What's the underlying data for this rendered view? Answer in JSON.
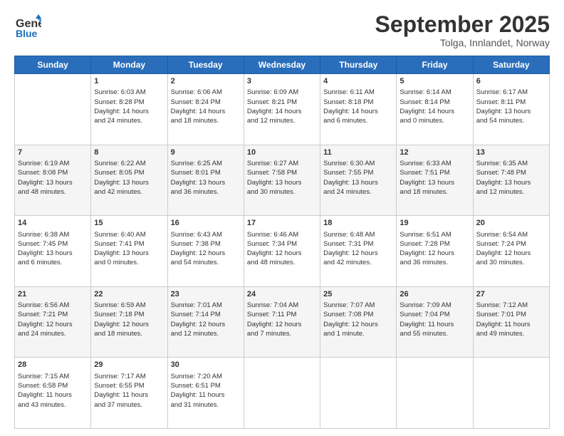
{
  "logo": {
    "text_general": "General",
    "text_blue": "Blue"
  },
  "title": "September 2025",
  "subtitle": "Tolga, Innlandet, Norway",
  "days": [
    "Sunday",
    "Monday",
    "Tuesday",
    "Wednesday",
    "Thursday",
    "Friday",
    "Saturday"
  ],
  "weeks": [
    [
      {
        "day": "",
        "content": ""
      },
      {
        "day": "1",
        "content": "Sunrise: 6:03 AM\nSunset: 8:28 PM\nDaylight: 14 hours\nand 24 minutes."
      },
      {
        "day": "2",
        "content": "Sunrise: 6:06 AM\nSunset: 8:24 PM\nDaylight: 14 hours\nand 18 minutes."
      },
      {
        "day": "3",
        "content": "Sunrise: 6:09 AM\nSunset: 8:21 PM\nDaylight: 14 hours\nand 12 minutes."
      },
      {
        "day": "4",
        "content": "Sunrise: 6:11 AM\nSunset: 8:18 PM\nDaylight: 14 hours\nand 6 minutes."
      },
      {
        "day": "5",
        "content": "Sunrise: 6:14 AM\nSunset: 8:14 PM\nDaylight: 14 hours\nand 0 minutes."
      },
      {
        "day": "6",
        "content": "Sunrise: 6:17 AM\nSunset: 8:11 PM\nDaylight: 13 hours\nand 54 minutes."
      }
    ],
    [
      {
        "day": "7",
        "content": "Sunrise: 6:19 AM\nSunset: 8:08 PM\nDaylight: 13 hours\nand 48 minutes."
      },
      {
        "day": "8",
        "content": "Sunrise: 6:22 AM\nSunset: 8:05 PM\nDaylight: 13 hours\nand 42 minutes."
      },
      {
        "day": "9",
        "content": "Sunrise: 6:25 AM\nSunset: 8:01 PM\nDaylight: 13 hours\nand 36 minutes."
      },
      {
        "day": "10",
        "content": "Sunrise: 6:27 AM\nSunset: 7:58 PM\nDaylight: 13 hours\nand 30 minutes."
      },
      {
        "day": "11",
        "content": "Sunrise: 6:30 AM\nSunset: 7:55 PM\nDaylight: 13 hours\nand 24 minutes."
      },
      {
        "day": "12",
        "content": "Sunrise: 6:33 AM\nSunset: 7:51 PM\nDaylight: 13 hours\nand 18 minutes."
      },
      {
        "day": "13",
        "content": "Sunrise: 6:35 AM\nSunset: 7:48 PM\nDaylight: 13 hours\nand 12 minutes."
      }
    ],
    [
      {
        "day": "14",
        "content": "Sunrise: 6:38 AM\nSunset: 7:45 PM\nDaylight: 13 hours\nand 6 minutes."
      },
      {
        "day": "15",
        "content": "Sunrise: 6:40 AM\nSunset: 7:41 PM\nDaylight: 13 hours\nand 0 minutes."
      },
      {
        "day": "16",
        "content": "Sunrise: 6:43 AM\nSunset: 7:38 PM\nDaylight: 12 hours\nand 54 minutes."
      },
      {
        "day": "17",
        "content": "Sunrise: 6:46 AM\nSunset: 7:34 PM\nDaylight: 12 hours\nand 48 minutes."
      },
      {
        "day": "18",
        "content": "Sunrise: 6:48 AM\nSunset: 7:31 PM\nDaylight: 12 hours\nand 42 minutes."
      },
      {
        "day": "19",
        "content": "Sunrise: 6:51 AM\nSunset: 7:28 PM\nDaylight: 12 hours\nand 36 minutes."
      },
      {
        "day": "20",
        "content": "Sunrise: 6:54 AM\nSunset: 7:24 PM\nDaylight: 12 hours\nand 30 minutes."
      }
    ],
    [
      {
        "day": "21",
        "content": "Sunrise: 6:56 AM\nSunset: 7:21 PM\nDaylight: 12 hours\nand 24 minutes."
      },
      {
        "day": "22",
        "content": "Sunrise: 6:59 AM\nSunset: 7:18 PM\nDaylight: 12 hours\nand 18 minutes."
      },
      {
        "day": "23",
        "content": "Sunrise: 7:01 AM\nSunset: 7:14 PM\nDaylight: 12 hours\nand 12 minutes."
      },
      {
        "day": "24",
        "content": "Sunrise: 7:04 AM\nSunset: 7:11 PM\nDaylight: 12 hours\nand 7 minutes."
      },
      {
        "day": "25",
        "content": "Sunrise: 7:07 AM\nSunset: 7:08 PM\nDaylight: 12 hours\nand 1 minute."
      },
      {
        "day": "26",
        "content": "Sunrise: 7:09 AM\nSunset: 7:04 PM\nDaylight: 11 hours\nand 55 minutes."
      },
      {
        "day": "27",
        "content": "Sunrise: 7:12 AM\nSunset: 7:01 PM\nDaylight: 11 hours\nand 49 minutes."
      }
    ],
    [
      {
        "day": "28",
        "content": "Sunrise: 7:15 AM\nSunset: 6:58 PM\nDaylight: 11 hours\nand 43 minutes."
      },
      {
        "day": "29",
        "content": "Sunrise: 7:17 AM\nSunset: 6:55 PM\nDaylight: 11 hours\nand 37 minutes."
      },
      {
        "day": "30",
        "content": "Sunrise: 7:20 AM\nSunset: 6:51 PM\nDaylight: 11 hours\nand 31 minutes."
      },
      {
        "day": "",
        "content": ""
      },
      {
        "day": "",
        "content": ""
      },
      {
        "day": "",
        "content": ""
      },
      {
        "day": "",
        "content": ""
      }
    ]
  ]
}
